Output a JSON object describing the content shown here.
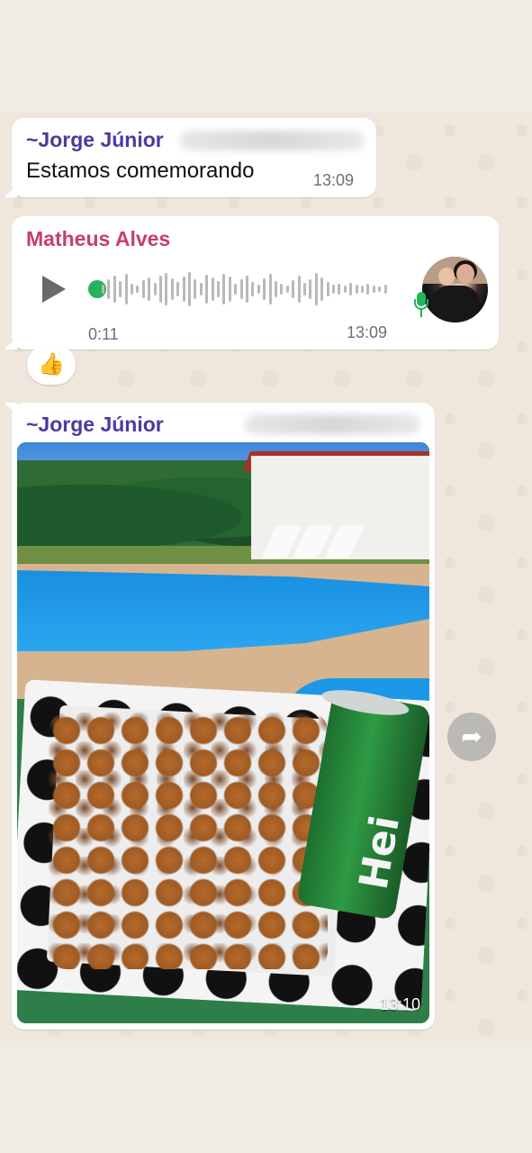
{
  "messages": [
    {
      "sender": "~Jorge Júnior",
      "sender_color": "#4b3aa0",
      "text": "Estamos comemorando",
      "time": "13:09"
    },
    {
      "sender": "Matheus Alves",
      "sender_color": "#c83c73",
      "type": "voice",
      "duration": "0:11",
      "time": "13:09",
      "reaction": "👍"
    },
    {
      "sender": "~Jorge Júnior",
      "sender_color": "#4b3aa0",
      "type": "photo",
      "time": "13:10"
    }
  ],
  "icons": {
    "play": "play-icon",
    "mic": "mic-icon",
    "forward": "forward-icon"
  },
  "colors": {
    "chat_bg": "#efe7dc",
    "bubble": "#ffffff",
    "accent_green": "#25b35b"
  }
}
